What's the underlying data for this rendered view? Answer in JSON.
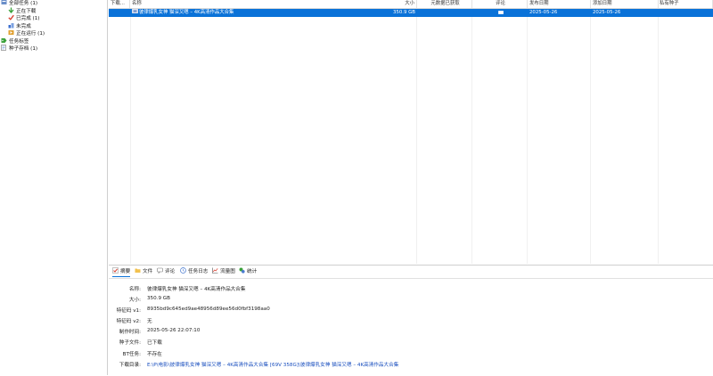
{
  "sidebar": {
    "items": [
      {
        "label": "全部任务 (1)",
        "icon": "all-tasks-icon",
        "indent": 0
      },
      {
        "label": "正在下载",
        "icon": "download-arrow-icon",
        "indent": 1
      },
      {
        "label": "已完成 (1)",
        "icon": "checkmark-icon",
        "indent": 1
      },
      {
        "label": "未完成",
        "icon": "incomplete-icon",
        "indent": 1
      },
      {
        "label": "正在运行 (1)",
        "icon": "running-icon",
        "indent": 1
      },
      {
        "label": "任务标签",
        "icon": "tag-icon",
        "indent": 0
      },
      {
        "label": "种子存档 (1)",
        "icon": "archive-icon",
        "indent": 0
      }
    ]
  },
  "list": {
    "columns": [
      "下载...",
      "名称",
      "大小",
      "元数据已获取",
      "评论",
      "发布日期",
      "添加日期",
      "私有种子"
    ],
    "rows": [
      {
        "name": "彼律爆乳女神 猫深又嗯 – 4K高清作品大合集",
        "size": "350.9 GB",
        "metadata": "",
        "comment": "",
        "published": "2025-05-26",
        "added": "2025-05-26",
        "private": ""
      }
    ]
  },
  "panel": {
    "tabs": [
      {
        "label": "摘要",
        "icon": "summary-check-icon"
      },
      {
        "label": "文件",
        "icon": "files-icon"
      },
      {
        "label": "评论",
        "icon": "comment-icon"
      },
      {
        "label": "任务日志",
        "icon": "log-icon"
      },
      {
        "label": "流量图",
        "icon": "chart-icon"
      },
      {
        "label": "统计",
        "icon": "stats-icon"
      }
    ],
    "props": [
      {
        "label": "名称:",
        "value": "彼律爆乳女神 猫深又嗯 – 4K高清作品大合集"
      },
      {
        "label": "大小:",
        "value": "350.9 GB"
      },
      {
        "label": "特征码 v1:",
        "value": "8935bd9c645ed9ae48956d89ee56d0fbf3198aa0"
      },
      {
        "label": "特征码 v2:",
        "value": "无"
      },
      {
        "label": "制作时间:",
        "value": "2025-05-26 22:07:10"
      },
      {
        "label": "种子文件:",
        "value": "已下载"
      },
      {
        "label": "BT任务:",
        "value": "不存在"
      },
      {
        "label": "下载目录:",
        "value": "E:\\P\\电影\\彼律爆乳女神 猫深又嗯 – 4K高清作品大合集 [69V 358G]\\彼律爆乳女神 猫深又嗯 – 4K高清作品大合集"
      }
    ]
  },
  "colors": {
    "selection": "#0a72d8",
    "link": "#1a4fbf"
  }
}
